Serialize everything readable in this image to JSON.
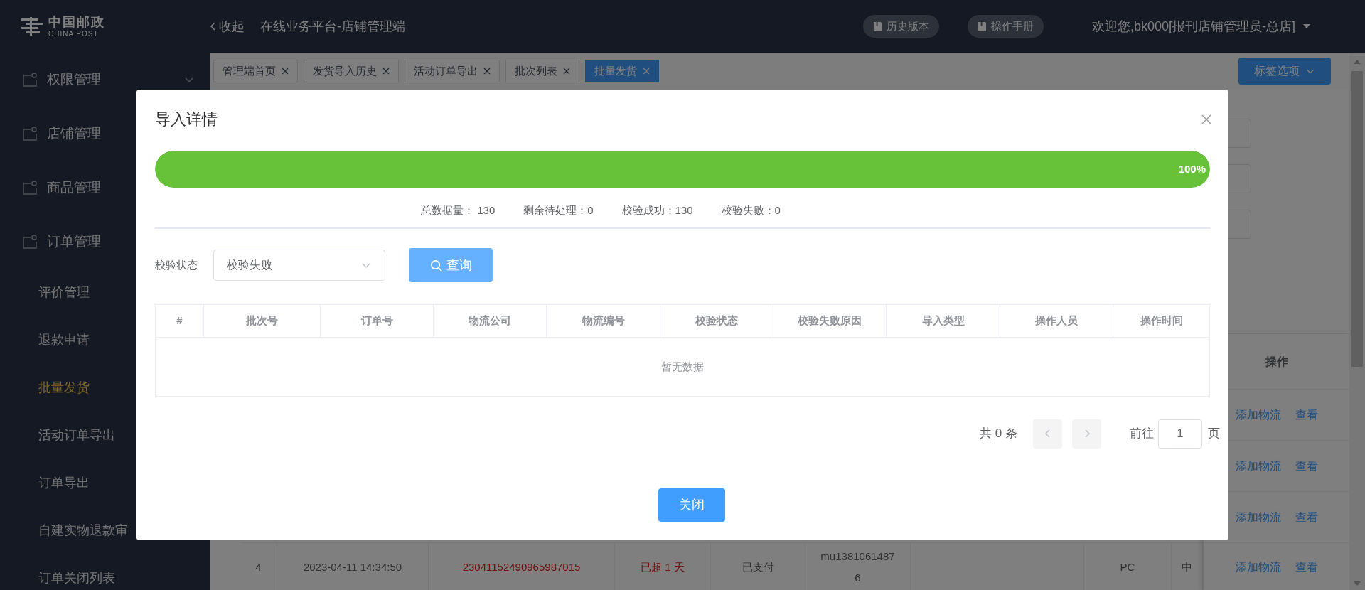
{
  "header": {
    "logo_name": "中国邮政",
    "logo_subtitle": "CHINA POST",
    "collapse": "收起",
    "title": "在线业务平台-店铺管理端",
    "buttons": [
      "历史版本",
      "操作手册"
    ],
    "user": "欢迎您,bk000[报刊店铺管理员-总店]"
  },
  "sidebar": {
    "groups": [
      {
        "label": "权限管理",
        "show_arrow": true
      },
      {
        "label": "店铺管理"
      },
      {
        "label": "商品管理"
      },
      {
        "label": "订单管理",
        "children": [
          {
            "label": "评价管理",
            "selected": false
          },
          {
            "label": "退款申请",
            "selected": false
          },
          {
            "label": "批量发货",
            "selected": true
          },
          {
            "label": "活动订单导出",
            "selected": false
          },
          {
            "label": "订单导出",
            "selected": false
          },
          {
            "label": "自建实物退款审",
            "selected": false
          },
          {
            "label": "订单关闭列表",
            "selected": false
          }
        ]
      }
    ]
  },
  "tabs": [
    {
      "label": "管理端首页",
      "selected": false
    },
    {
      "label": "发货导入历史",
      "selected": false
    },
    {
      "label": "活动订单导出",
      "selected": false
    },
    {
      "label": "批次列表",
      "selected": false
    },
    {
      "label": "批量发货",
      "selected": true
    }
  ],
  "tab_options": "标签选项",
  "orders_table": {
    "action_header": "操作",
    "rows": [
      {
        "cells": [],
        "actions": [
          "添加物流",
          "查看"
        ]
      },
      {
        "cells": [],
        "actions": [
          "添加物流",
          "查看"
        ]
      },
      {
        "cells": [],
        "actions": [
          "添加物流",
          "查看"
        ]
      },
      {
        "cells": [
          {
            "text": "4",
            "alert": false
          },
          {
            "text": "2023-04-11 14:34:50",
            "alert": false
          },
          {
            "text": "23041152490965987015",
            "alert": true
          },
          {
            "text": "已超 1 天",
            "alert": true
          },
          {
            "text": "已支付",
            "alert": false
          },
          {
            "text": "mu13810614876",
            "alert": false
          },
          {},
          {
            "text": "PC",
            "alert": false
          },
          {
            "text": "中",
            "alert": false
          }
        ],
        "actions": [
          "添加物流",
          "查看"
        ]
      }
    ]
  },
  "dialog": {
    "title": "导入详情",
    "progress": {
      "level": 1,
      "reading": "100%"
    },
    "stats": [
      "总数据量： 130",
      "剩余待处理：0",
      "校验成功：130",
      "校验失败：0"
    ],
    "filter": {
      "label": "校验状态",
      "value": "校验失败"
    },
    "query_button": "查询",
    "table": {
      "columns": [
        "#",
        "批次号",
        "订单号",
        "物流公司",
        "物流编号",
        "校验状态",
        "校验失败原因",
        "导入类型",
        "操作人员",
        "操作时间"
      ],
      "empty_text": "暂无数据"
    },
    "pagination": {
      "total": "共 0 条",
      "prev_disabled": true,
      "next_disabled": true,
      "goto": "前往",
      "page": "1",
      "page_suffix": "页"
    },
    "close_button": "关闭"
  }
}
